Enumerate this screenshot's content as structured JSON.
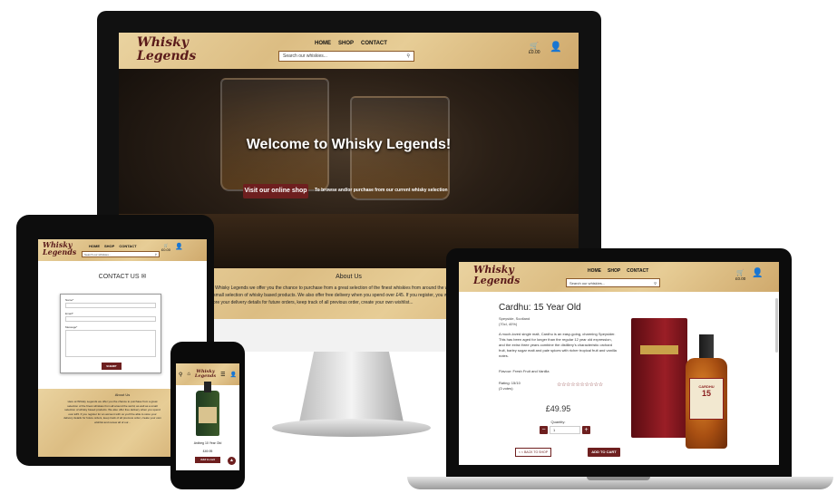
{
  "site": {
    "logo_line1": "Whisky",
    "logo_line2": "Legends",
    "nav": [
      "HOME",
      "SHOP",
      "CONTACT"
    ],
    "search_placeholder": "Search our whiskies...",
    "cart_total": "£0.00"
  },
  "desktop": {
    "hero_title": "Welcome to Whisky Legends!",
    "visit_button": "Visit our online shop",
    "browse_text": "To browse and/or purchase from our current whisky selection",
    "about_title": "About Us",
    "about_text": "At Whisky Legends we offer you the chance to purchase from a great selection of the finest whiskies from around the world, as well as a small selection of whisky based products. We also offer free delivery when you spend over £45. If you register, you will be able to store your delivery details for future orders, keep track of all previous order, create your own wishlist..."
  },
  "tablet": {
    "contact_title": "CONTACT US",
    "form_labels": [
      "Name*",
      "Email*",
      "Message*"
    ],
    "submit": "SUBMIT",
    "about_title": "About Us",
    "about_text": "Here at Whisky Legends we offer you the chance to purchase from a great selection of the finest whiskies from all around the world, as well as a small selection of whisky based products. We also offer free delivery when you spend over £45. If you register for an account with us you'll be able to store your delivery details for future orders, keep track of all previous order, create your own wishlist and review all of our..."
  },
  "phone": {
    "product_name": "Ardbeg 10 Year Old",
    "price": "£49.95",
    "add_button": "Add to cart"
  },
  "laptop": {
    "product_title": "Cardhu: 15 Year Old",
    "region": "Speyside, Scotland",
    "specs": "(70cl, 40%)",
    "description": "A much-loved single malt, Cardhu is an easy-going, charming Speysider. This has been aged for longer than the regular 12 year old expression, and the extra three years combine the distillery's characteristic orchard fruit, barley sugar malt and pale spices with richer tropical fruit and vanilla notes.",
    "flavour": "Flavour: Fresh Fruit and Vanilla",
    "rating_label": "Rating: 15/10",
    "rating_count": "(3 votes)",
    "stars": "☆☆☆☆☆☆☆☆☆☆",
    "price": "£49.95",
    "quantity_label": "Quantity:",
    "quantity_value": "1",
    "back_button": "< < BACK TO SHOP",
    "add_button": "ADD TO CART",
    "bottle_label": "CARDHU",
    "bottle_age": "15"
  }
}
